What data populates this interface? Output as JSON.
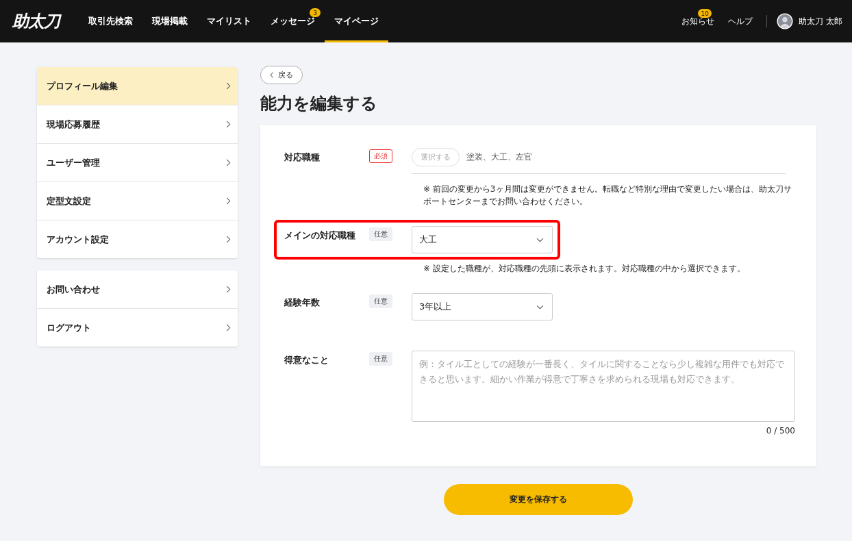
{
  "header": {
    "logo": "助太刀",
    "nav": [
      {
        "label": "取引先検索",
        "selected": false
      },
      {
        "label": "現場掲載",
        "selected": false
      },
      {
        "label": "マイリスト",
        "selected": false
      },
      {
        "label": "メッセージ",
        "selected": false,
        "badge": "3"
      },
      {
        "label": "マイページ",
        "selected": true
      }
    ],
    "notifications": {
      "label": "お知らせ",
      "badge": "10"
    },
    "help": "ヘルプ",
    "user": {
      "name": "助太刀 太郎"
    }
  },
  "sidebar": {
    "groups": [
      {
        "items": [
          {
            "label": "プロフィール編集",
            "selected": true
          },
          {
            "label": "現場応募履歴",
            "selected": false
          },
          {
            "label": "ユーザー管理",
            "selected": false
          },
          {
            "label": "定型文設定",
            "selected": false
          },
          {
            "label": "アカウント設定",
            "selected": false
          }
        ]
      },
      {
        "items": [
          {
            "label": "お問い合わせ",
            "selected": false
          },
          {
            "label": "ログアウト",
            "selected": false
          }
        ]
      }
    ]
  },
  "back_button": "戻る",
  "page_title": "能力を編集する",
  "fields": [
    {
      "kind": "chips",
      "label": "対応職種",
      "required": true,
      "badge": "必須",
      "button": "選択する",
      "value": "塗装、大工、左官",
      "note": "※ 前回の変更から3ヶ月間は変更ができません。転職など特別な理由で変更したい場合は、助太刀サポートセンターまでお問い合わせください。",
      "highlighted": false
    },
    {
      "kind": "select",
      "label": "メインの対応職種",
      "required": false,
      "badge": "任意",
      "value": "大工",
      "note": "※ 設定した職種が、対応職種の先頭に表示されます。対応職種の中から選択できます。",
      "highlighted": true
    },
    {
      "kind": "select",
      "label": "経験年数",
      "required": false,
      "badge": "任意",
      "value": "3年以上",
      "highlighted": false
    },
    {
      "kind": "textarea",
      "label": "得意なこと",
      "required": false,
      "badge": "任意",
      "placeholder": "例：タイル工としての経験が一番長く、タイルに関することなら少し複雑な用件でも対応できると思います。細かい作業が得意で丁寧さを求められる現場も対応できます。",
      "counter": "0 / 500",
      "highlighted": false
    }
  ],
  "save_button": "変更を保存する"
}
